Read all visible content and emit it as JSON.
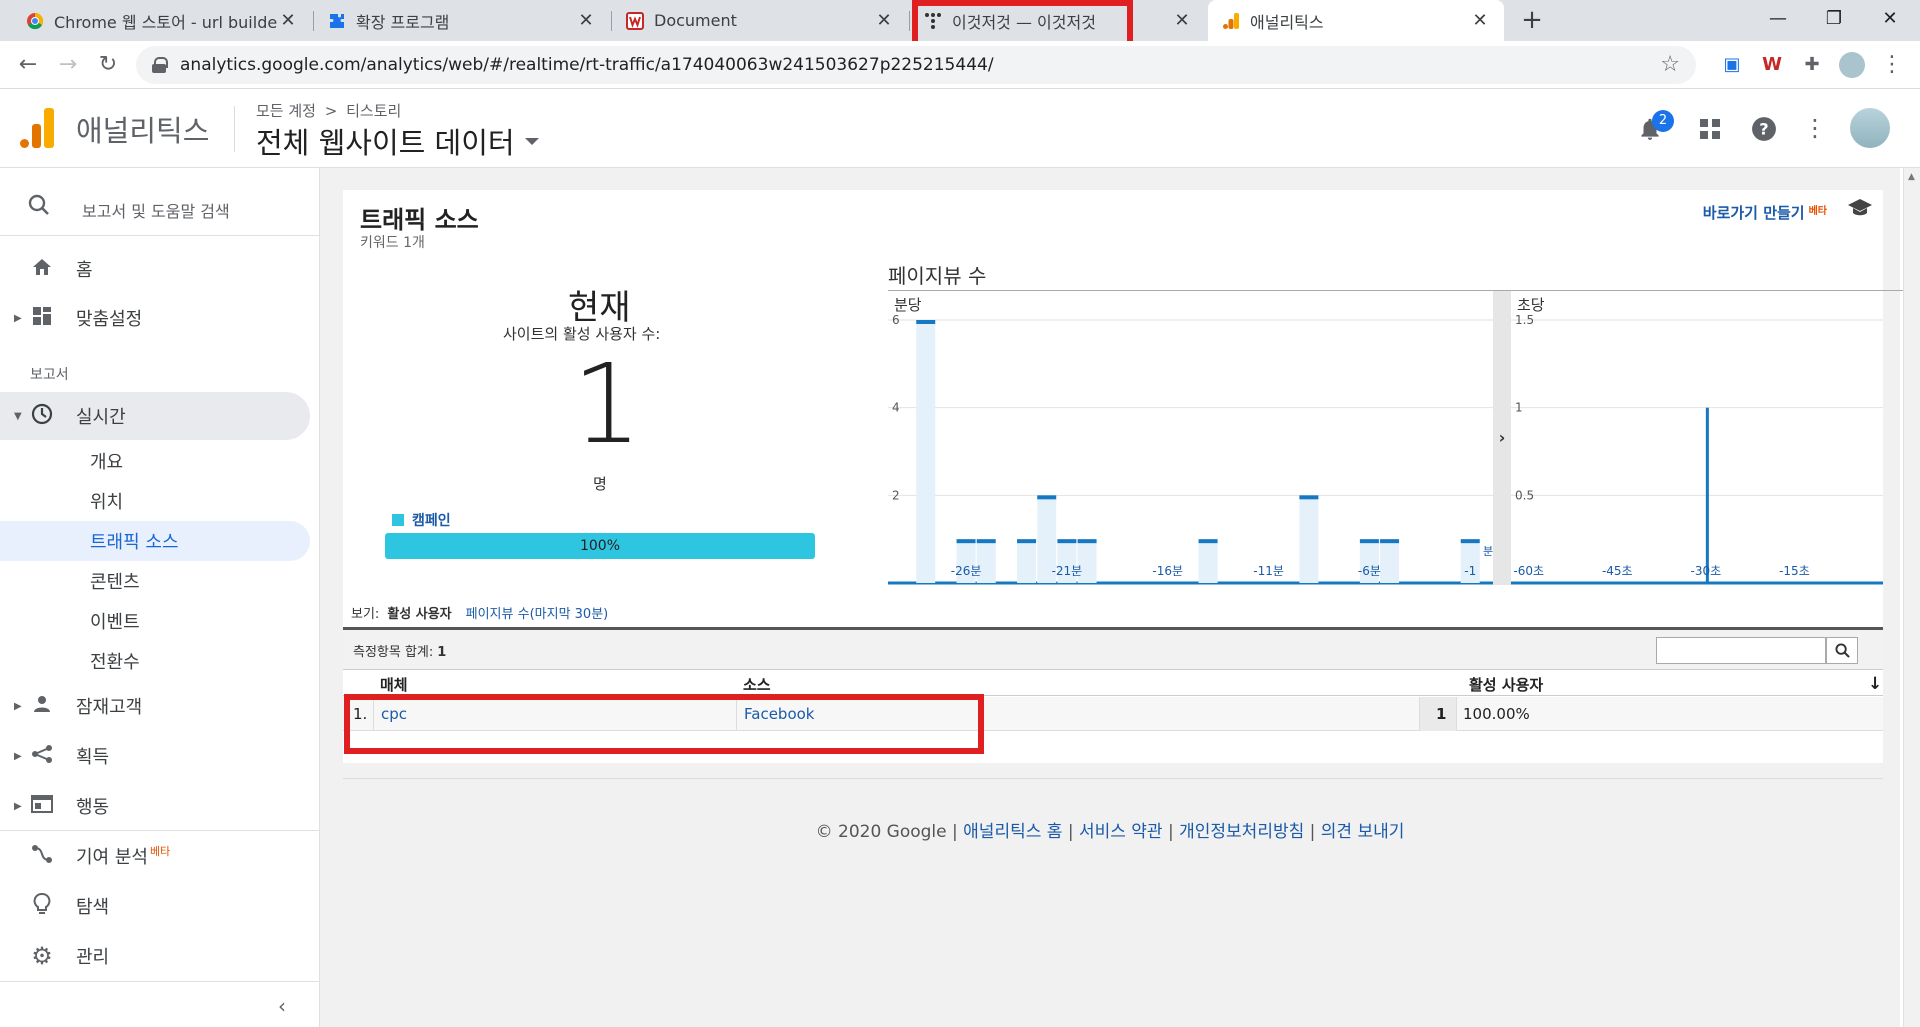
{
  "browser": {
    "tabs": [
      {
        "title": "Chrome 웹 스토어 - url builder",
        "icon": "chrome-webstore-icon"
      },
      {
        "title": "확장 프로그램",
        "icon": "puzzle-icon"
      },
      {
        "title": "Document",
        "icon": "document-favicon"
      },
      {
        "title": "이것저것 — 이것저것",
        "icon": "tistory-icon"
      },
      {
        "title": "애널리틱스",
        "icon": "analytics-icon"
      }
    ],
    "active_tab": 4,
    "url": "analytics.google.com/analytics/web/#/realtime/rt-traffic/a174040063w241503627p225215444/"
  },
  "header": {
    "app_name": "애널리틱스",
    "breadcrumb_account": "모든 계정",
    "breadcrumb_sep": ">",
    "breadcrumb_property": "티스토리",
    "view_name": "전체 웹사이트 데이터",
    "notification_count": "2"
  },
  "sidebar": {
    "search_placeholder": "보고서 및 도움말 검색",
    "home": "홈",
    "custom": "맞춤설정",
    "section_reports": "보고서",
    "realtime": "실시간",
    "realtime_sub": [
      "개요",
      "위치",
      "트래픽 소스",
      "콘텐츠",
      "이벤트",
      "전환수"
    ],
    "audience": "잠재고객",
    "acquisition": "획득",
    "behavior": "행동",
    "attribution": "기여 분석",
    "attribution_badge": "베타",
    "discover": "탐색",
    "admin": "관리"
  },
  "report": {
    "title": "트래픽 소스",
    "subtitle": "키워드 1개",
    "shortcut": "바로가기 만들기",
    "shortcut_badge": "베타",
    "now_label": "현재",
    "now_sub": "사이트의 활성 사용자 수:",
    "now_count": "1",
    "now_unit": "명",
    "legend_label": "캠페인",
    "legend_percent": "100%",
    "view_label": "보기:",
    "view_active": "활성 사용자",
    "view_other": "페이지뷰 수(마지막 30분)",
    "metric_total_label": "측정항목 합계:",
    "metric_total_value": "1",
    "columns": {
      "medium": "매체",
      "source": "소스",
      "active_users": "활성 사용자"
    },
    "rows": [
      {
        "index": "1.",
        "medium": "cpc",
        "source": "Facebook",
        "count": "1",
        "percent": "100.00%"
      }
    ]
  },
  "chart_data": [
    {
      "type": "bar",
      "title": "페이지뷰 수",
      "panel_label": "분당",
      "x": [
        -29,
        -28,
        -27,
        -26,
        -25,
        -24,
        -23,
        -22,
        -21,
        -20,
        -19,
        -18,
        -17,
        -16,
        -15,
        -14,
        -13,
        -12,
        -11,
        -10,
        -9,
        -8,
        -7,
        -6,
        -5,
        -4,
        -3,
        -2,
        -1,
        0
      ],
      "values": [
        0,
        6,
        0,
        1,
        1,
        0,
        1,
        2,
        1,
        1,
        0,
        0,
        0,
        0,
        0,
        1,
        0,
        0,
        0,
        0,
        2,
        0,
        0,
        1,
        1,
        0,
        0,
        0,
        1,
        0
      ],
      "x_ticks": [
        "-26분",
        "-21분",
        "-16분",
        "-11분",
        "-6분",
        "-1"
      ],
      "x_tick_values": [
        -26,
        -21,
        -16,
        -11,
        -6,
        -1
      ],
      "y_ticks": [
        2,
        4,
        6
      ],
      "ylim": [
        0,
        6
      ],
      "edge_label": "분"
    },
    {
      "type": "bar",
      "panel_label": "초당",
      "x": [
        -30
      ],
      "values": [
        1
      ],
      "x_ticks": [
        "-60초",
        "-45초",
        "-30초",
        "-15초"
      ],
      "x_tick_values": [
        -60,
        -45,
        -30,
        -15
      ],
      "y_ticks": [
        0.5,
        1,
        1.5
      ],
      "ylim": [
        0,
        1.5
      ]
    }
  ],
  "footer": {
    "copyright": "© 2020 Google",
    "links": [
      "애널리틱스 홈",
      "서비스 약관",
      "개인정보처리방침",
      "의견 보내기"
    ]
  }
}
